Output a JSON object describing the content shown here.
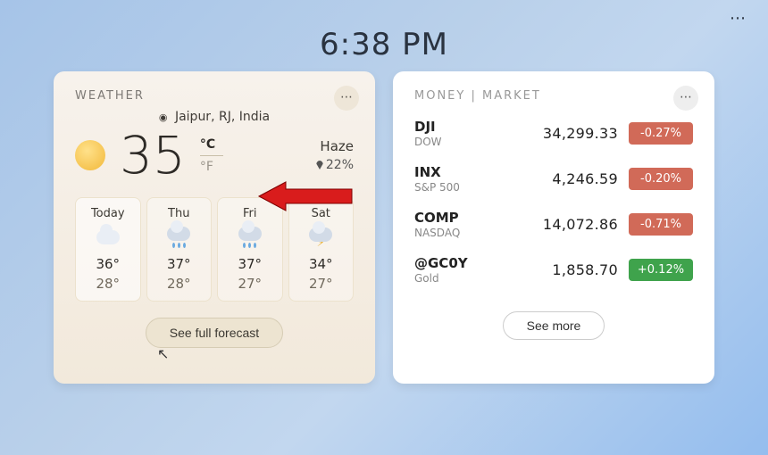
{
  "clock": "6:38 PM",
  "weather": {
    "title": "WEATHER",
    "location": "Jaipur, RJ, India",
    "temp": "35",
    "unit_c": "°C",
    "unit_f": "°F",
    "condition": "Haze",
    "humidity": "22%",
    "forecast": [
      {
        "day": "Today",
        "icon": "cloud-sun",
        "hi": "36°",
        "lo": "28°"
      },
      {
        "day": "Thu",
        "icon": "rain",
        "hi": "37°",
        "lo": "28°"
      },
      {
        "day": "Fri",
        "icon": "rain",
        "hi": "37°",
        "lo": "27°"
      },
      {
        "day": "Sat",
        "icon": "storm",
        "hi": "34°",
        "lo": "27°"
      }
    ],
    "button": "See full forecast"
  },
  "money": {
    "title": "MONEY | MARKET",
    "rows": [
      {
        "sym": "DJI",
        "sub": "DOW",
        "val": "34,299.33",
        "chg": "-0.27%",
        "dir": "down"
      },
      {
        "sym": "INX",
        "sub": "S&P 500",
        "val": "4,246.59",
        "chg": "-0.20%",
        "dir": "down"
      },
      {
        "sym": "COMP",
        "sub": "NASDAQ",
        "val": "14,072.86",
        "chg": "-0.71%",
        "dir": "down"
      },
      {
        "sym": "@GC0Y",
        "sub": "Gold",
        "val": "1,858.70",
        "chg": "+0.12%",
        "dir": "up"
      }
    ],
    "button": "See more"
  }
}
